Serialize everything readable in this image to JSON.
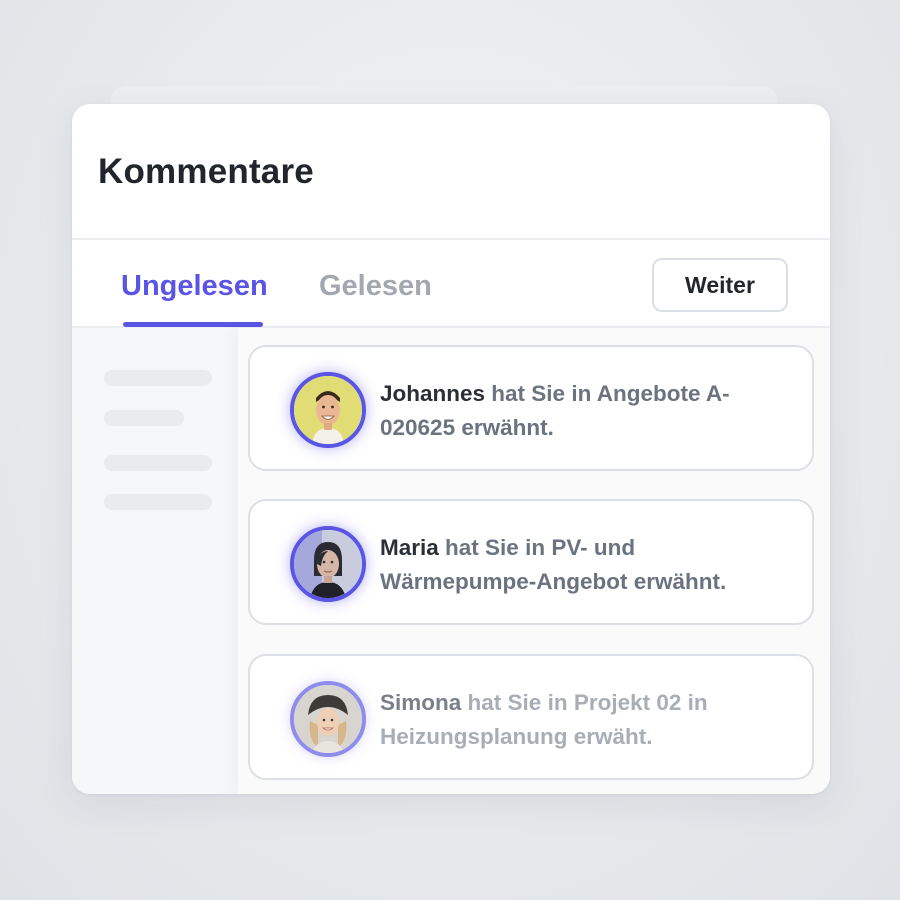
{
  "title": "Kommentare",
  "tabs": [
    {
      "label": "Ungelesen",
      "active": true
    },
    {
      "label": "Gelesen",
      "active": false
    }
  ],
  "next_button_label": "Weiter",
  "colors": {
    "accent": "#5b55e6",
    "inactive_tab": "#a2a7b0",
    "text_dark": "#2b2e36",
    "text_muted": "#6b7280"
  },
  "notifications": [
    {
      "name": "Johannes",
      "message": "hat Sie in Angebote A-020625 erwähnt.",
      "avatar": "avatar-photo-johannes"
    },
    {
      "name": "Maria",
      "message": "hat Sie in PV- und Wärmepumpe-Angebot erwähnt.",
      "avatar": "avatar-photo-maria"
    },
    {
      "name": "Simona",
      "message": "hat Sie in Projekt 02 in Heizungsplanung erwäht.",
      "avatar": "avatar-photo-simona"
    }
  ]
}
